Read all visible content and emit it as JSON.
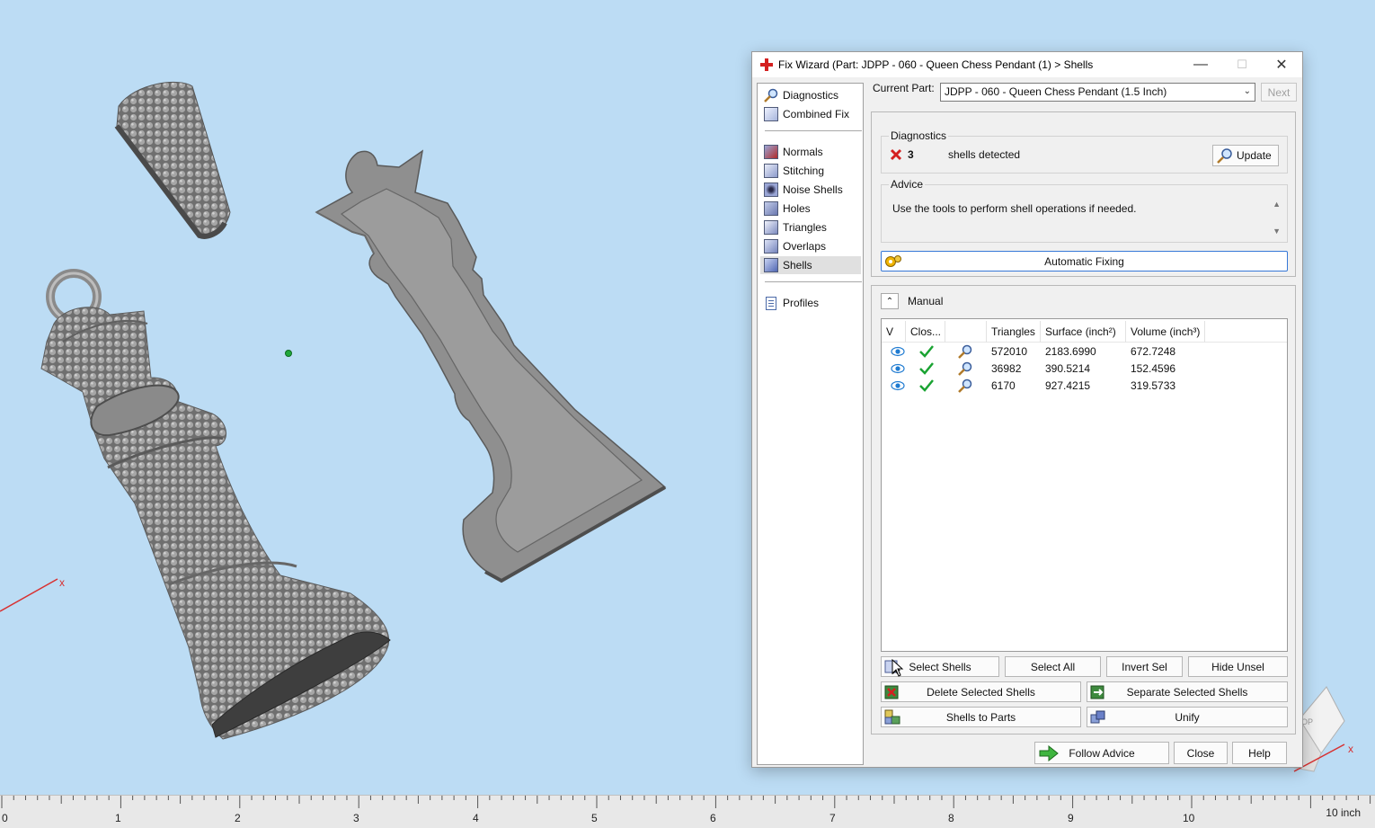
{
  "window": {
    "title": "Fix Wizard (Part: JDPP - 060 - Queen Chess Pendant (1) > Shells",
    "minimize": "—",
    "maximize": "☐",
    "close": "✕"
  },
  "nav": {
    "items": [
      {
        "label": "Diagnostics",
        "icon": "magnifier-icon"
      },
      {
        "label": "Combined Fix",
        "icon": "cube-stack-icon"
      },
      {
        "label": "Normals",
        "icon": "normals-icon"
      },
      {
        "label": "Stitching",
        "icon": "stitching-icon"
      },
      {
        "label": "Noise Shells",
        "icon": "noise-shells-icon"
      },
      {
        "label": "Holes",
        "icon": "holes-icon"
      },
      {
        "label": "Triangles",
        "icon": "triangles-icon"
      },
      {
        "label": "Overlaps",
        "icon": "overlaps-icon"
      },
      {
        "label": "Shells",
        "icon": "shells-icon"
      },
      {
        "label": "Profiles",
        "icon": "profiles-icon"
      }
    ],
    "active": "Shells"
  },
  "current_part": {
    "label": "Current Part:",
    "value": "JDPP - 060 - Queen Chess Pendant (1.5 Inch)",
    "next_label": "Next"
  },
  "diagnostics": {
    "title": "Diagnostics",
    "count": "3",
    "text": "shells detected",
    "update_label": "Update"
  },
  "advice": {
    "title": "Advice",
    "text": "Use the tools to perform shell operations if needed."
  },
  "automatic_fixing_label": "Automatic Fixing",
  "manual": {
    "title": "Manual",
    "columns": [
      "V",
      "Clos...",
      "",
      "Triangles",
      "Surface (inch²)",
      "Volume (inch³)"
    ],
    "rows": [
      {
        "triangles": "572010",
        "surface": "2183.6990",
        "volume": "672.7248"
      },
      {
        "triangles": "36982",
        "surface": "390.5214",
        "volume": "152.4596"
      },
      {
        "triangles": "6170",
        "surface": "927.4215",
        "volume": "319.5733"
      }
    ]
  },
  "buttons": {
    "select_shells": "Select Shells",
    "select_all": "Select All",
    "invert_sel": "Invert Sel",
    "hide_unsel": "Hide Unsel",
    "delete_selected_shells": "Delete Selected Shells",
    "separate_selected_shells": "Separate Selected Shells",
    "shells_to_parts": "Shells to Parts",
    "unify": "Unify",
    "follow_advice": "Follow Advice",
    "close": "Close",
    "help": "Help"
  },
  "ruler": {
    "numbers": [
      "0",
      "1",
      "2",
      "3",
      "4",
      "5",
      "6",
      "7",
      "8",
      "9",
      "10"
    ],
    "unit": "10 inch"
  },
  "axis_labels": {
    "x_left": "x",
    "x_right": "x",
    "view_cube": "OP"
  },
  "colors": {
    "viewport_bg": "#bcdcf4",
    "model_gray": "#8c8c8c",
    "check_green": "#1aa332",
    "error_red": "#d42020",
    "eye_blue": "#1f7bd1",
    "focus_blue": "#3778d7"
  }
}
